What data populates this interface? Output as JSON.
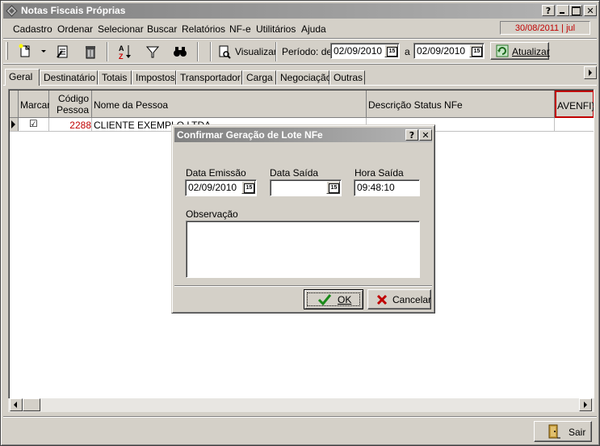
{
  "window": {
    "title": "Notas Fiscais Próprias",
    "help": "?",
    "minimize": "_",
    "maximize": "□",
    "close": "✕"
  },
  "menu": {
    "items": [
      {
        "label": "Cadastro"
      },
      {
        "label": "Ordenar"
      },
      {
        "label": "Selecionar"
      },
      {
        "label": "Buscar"
      },
      {
        "label": "Relatórios"
      },
      {
        "label": "NF-e"
      },
      {
        "label": "Utilitários"
      },
      {
        "label": "Ajuda"
      }
    ],
    "date_info": "30/08/2011 | jul"
  },
  "toolbar": {
    "visualizar": "Visualizar",
    "periodo_label": "Período: de",
    "periodo_from": "02/09/2010",
    "a_label": "a",
    "periodo_to": "02/09/2010",
    "atualizar": "Atualizar"
  },
  "tabs": [
    {
      "label": "Geral"
    },
    {
      "label": "Destinatário"
    },
    {
      "label": "Totais"
    },
    {
      "label": "Impostos"
    },
    {
      "label": "Transportador"
    },
    {
      "label": "Carga"
    },
    {
      "label": "Negociação"
    },
    {
      "label": "Outras"
    }
  ],
  "grid": {
    "headers": {
      "marcar": "Marcar",
      "codigo1": "Código",
      "codigo2": "Pessoa",
      "nome": "Nome da Pessoa",
      "status": "Descrição Status NFe",
      "avenfi": "AVENFI}"
    },
    "rows": [
      {
        "marcar": "☑",
        "codigo": "2288",
        "nome": "CLIENTE EXEMPLO LTDA",
        "status": ""
      }
    ]
  },
  "dialog": {
    "title": "Confirmar Geração de Lote NFe",
    "help": "?",
    "close": "✕",
    "data_emissao_label": "Data Emissão",
    "data_emissao": "02/09/2010",
    "data_saida_label": "Data Saída",
    "data_saida": "",
    "hora_saida_label": "Hora Saída",
    "hora_saida": "09:48:10",
    "observacao_label": "Observação",
    "observacao": "",
    "ok": "OK",
    "cancelar": "Cancelar"
  },
  "footer": {
    "sair": "Sair"
  },
  "calendar_glyph": "15"
}
